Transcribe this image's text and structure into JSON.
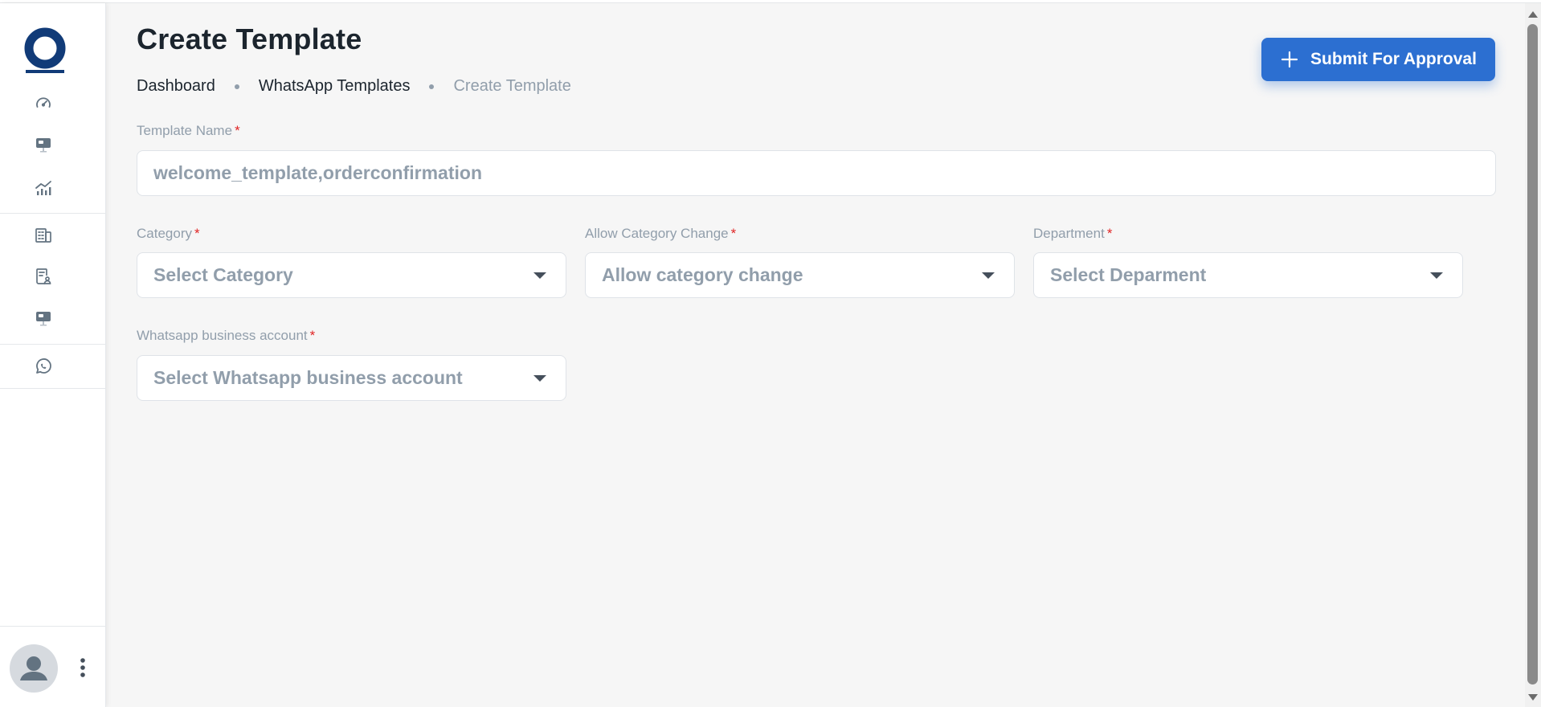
{
  "app": {
    "logo_name": "brand-logo",
    "accent_color": "#2c6fd1",
    "brand_color": "#113b78"
  },
  "sidebar": {
    "groups": [
      {
        "items": [
          {
            "icon": "speedometer-icon",
            "name": "nav-dashboard"
          },
          {
            "icon": "monitor-icon",
            "name": "nav-monitor"
          },
          {
            "icon": "analytics-chart-icon",
            "name": "nav-analytics"
          }
        ]
      },
      {
        "items": [
          {
            "icon": "building-icon",
            "name": "nav-organization"
          },
          {
            "icon": "user-document-icon",
            "name": "nav-user-records"
          },
          {
            "icon": "monitor-icon",
            "name": "nav-display"
          }
        ]
      },
      {
        "items": [
          {
            "icon": "whatsapp-icon",
            "name": "nav-whatsapp"
          }
        ]
      }
    ],
    "footer": {
      "avatar_icon": "user-avatar-icon",
      "menu_icon": "more-vertical-icon"
    }
  },
  "header": {
    "title": "Create Template",
    "breadcrumb": [
      "Dashboard",
      "WhatsApp Templates",
      "Create Template"
    ],
    "submit_label": "Submit For Approval",
    "submit_icon": "plus-icon"
  },
  "form": {
    "template_name": {
      "label": "Template Name",
      "required": "*",
      "placeholder": "welcome_template,orderconfirmation"
    },
    "category": {
      "label": "Category",
      "required": "*",
      "placeholder": "Select Category"
    },
    "allow_category_change": {
      "label": "Allow Category Change",
      "required": "*",
      "placeholder": "Allow category change"
    },
    "department": {
      "label": "Department",
      "required": "*",
      "placeholder": "Select Deparment"
    },
    "whatsapp_account": {
      "label": "Whatsapp business account",
      "required": "*",
      "placeholder": "Select Whatsapp business account"
    }
  }
}
